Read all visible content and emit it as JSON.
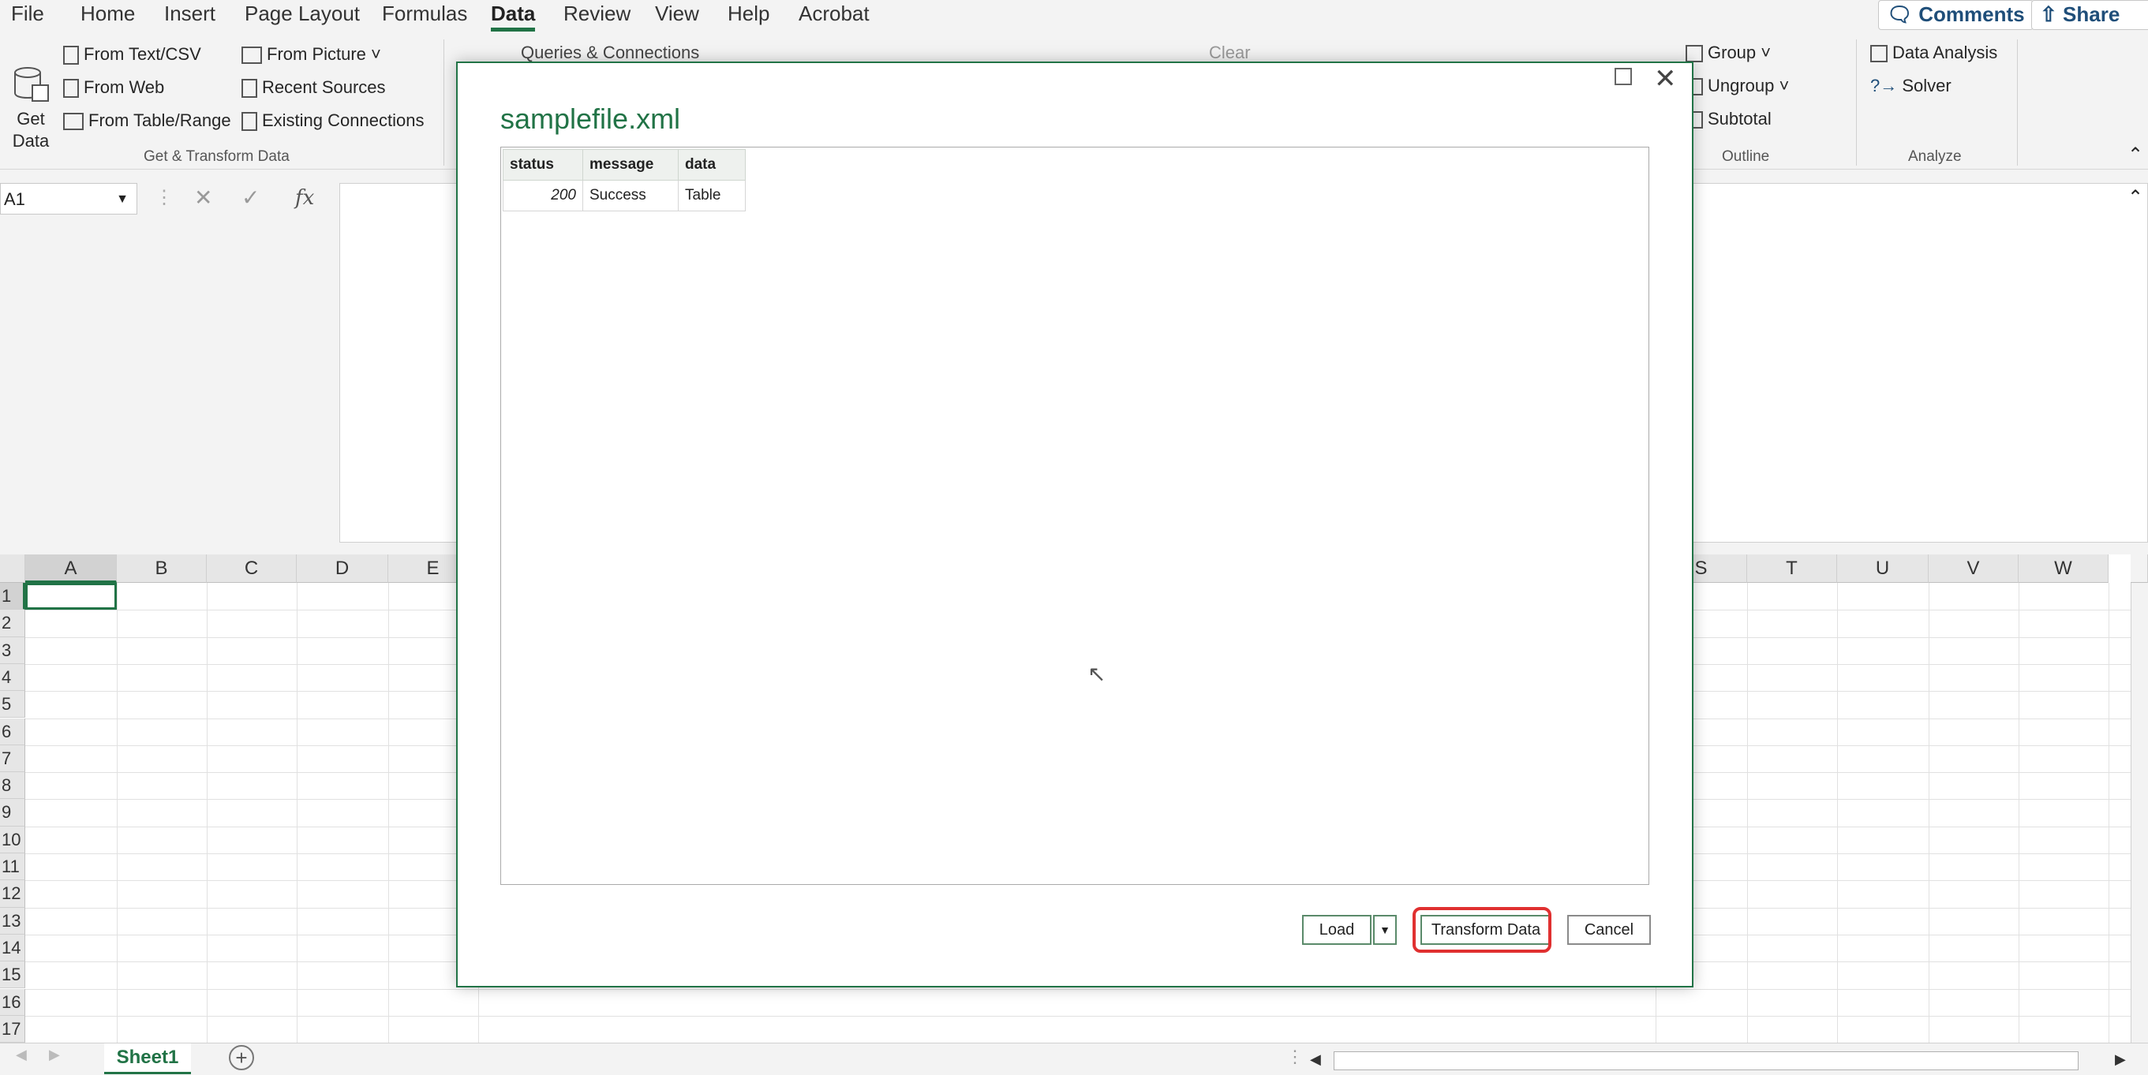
{
  "ribbon_tabs": [
    "File",
    "Home",
    "Insert",
    "Page Layout",
    "Formulas",
    "Data",
    "Review",
    "View",
    "Help",
    "Acrobat"
  ],
  "active_tab": "Data",
  "top_buttons": {
    "comments": "Comments",
    "share": "Share"
  },
  "get_transform": {
    "get_data": "Get\nData",
    "from_text_csv": "From Text/CSV",
    "from_web": "From Web",
    "from_table_range": "From Table/Range",
    "from_picture": "From Picture",
    "recent_sources": "Recent Sources",
    "existing_connections": "Existing Connections",
    "group_label": "Get & Transform Data"
  },
  "queries": {
    "queries_connections": "Queries & Connections",
    "clear": "Clear"
  },
  "outline": {
    "group": "Group",
    "ungroup": "Ungroup",
    "subtotal": "Subtotal",
    "label": "Outline"
  },
  "analyze": {
    "data_analysis": "Data Analysis",
    "solver": "Solver",
    "label": "Analyze"
  },
  "name_box": "A1",
  "fx": "fx",
  "columns_left": [
    "A",
    "B",
    "C",
    "D",
    "E"
  ],
  "columns_right": [
    "S",
    "T",
    "U",
    "V",
    "W"
  ],
  "rows": [
    "1",
    "2",
    "3",
    "4",
    "5",
    "6",
    "7",
    "8",
    "9",
    "10",
    "11",
    "12",
    "13",
    "14",
    "15",
    "16",
    "17"
  ],
  "sheet_tab": "Sheet1",
  "dialog": {
    "title": "samplefile.xml",
    "table": {
      "headers": [
        "status",
        "message",
        "data"
      ],
      "rows": [
        [
          "200",
          "Success",
          "Table"
        ]
      ]
    },
    "load_button": "Load",
    "transform_button": "Transform Data",
    "cancel_button": "Cancel"
  },
  "colors": {
    "accent": "#217346",
    "highlight": "#e03030"
  }
}
